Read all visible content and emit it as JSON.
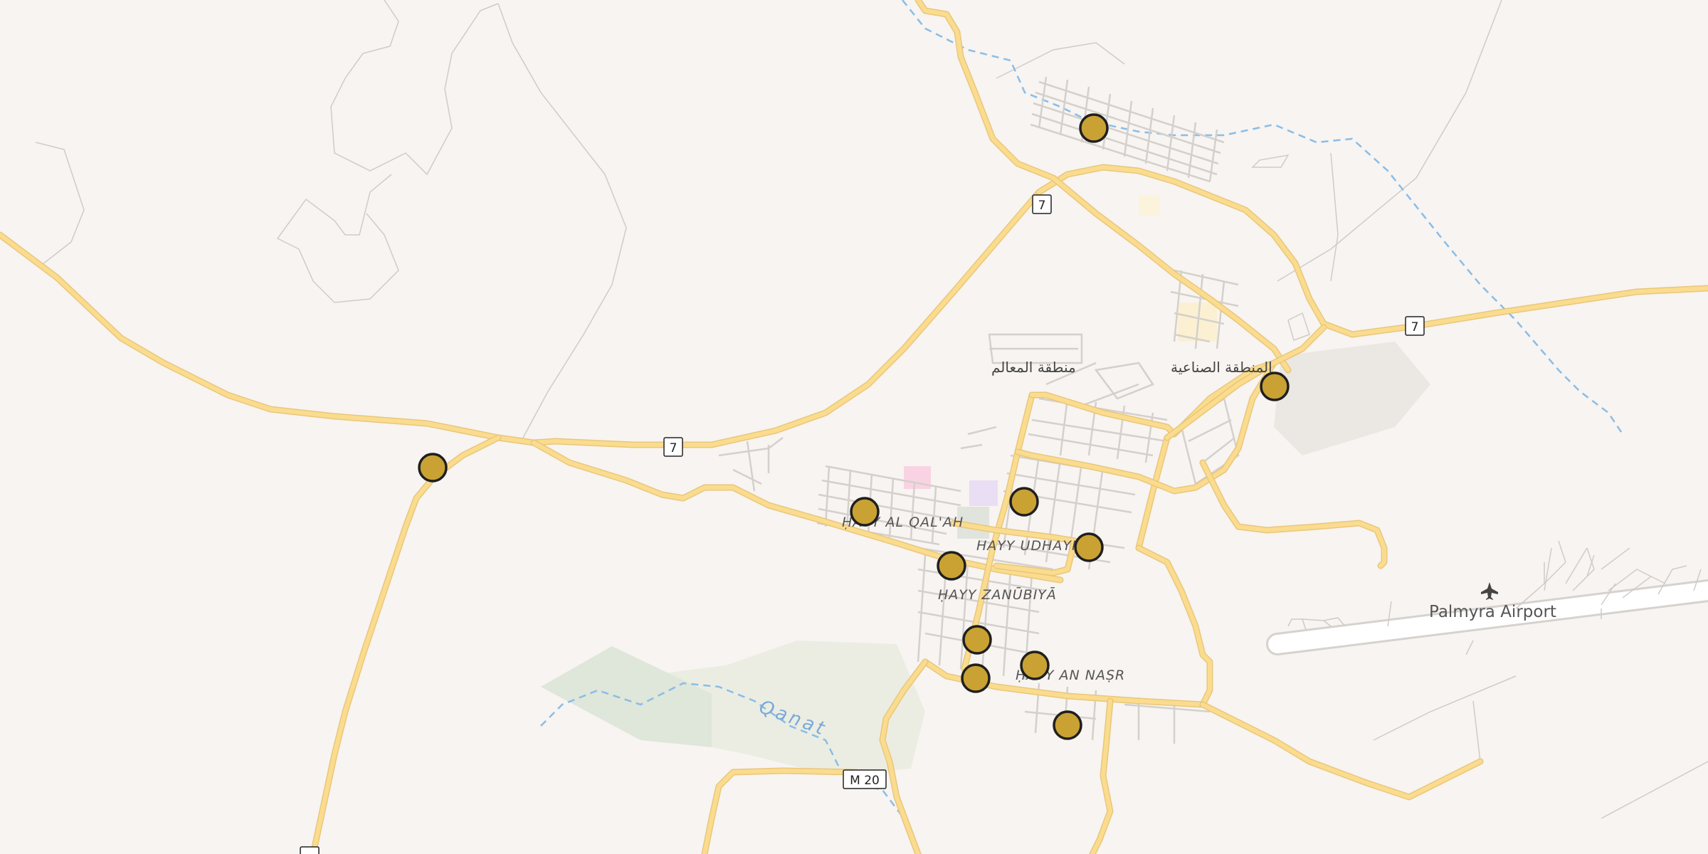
{
  "map": {
    "labels": {
      "hayy_al_qalah": "ḤAYY AL QAL'AH",
      "hayy_udhaynah": "HAYY UDHAYNAH",
      "hayy_zanubiya": "ḤAYY ZANŪBIYĀ",
      "hayy_an_nasr": "ḤAYY AN NAṢR",
      "monuments_area": "منطقة المعالم",
      "industrial_area": "المنطقة الصناعية",
      "airport": "Palmyra Airport",
      "qanat": "Qanat"
    },
    "shields": {
      "route_7": "7",
      "route_m20": "M 20"
    },
    "markers": [
      {
        "id": "marker-north"
      },
      {
        "id": "marker-west"
      },
      {
        "id": "marker-industrial"
      },
      {
        "id": "marker-qalah"
      },
      {
        "id": "marker-center"
      },
      {
        "id": "marker-udhaynah"
      },
      {
        "id": "marker-zanubiya-west"
      },
      {
        "id": "marker-zanubiya-south"
      },
      {
        "id": "marker-nasr-west"
      },
      {
        "id": "marker-nasr-east"
      },
      {
        "id": "marker-south"
      }
    ],
    "colors": {
      "background": "#f7f4f1",
      "major_road": "#fbdc8f",
      "water": "#89bde8",
      "marker": "#c9a233"
    }
  }
}
